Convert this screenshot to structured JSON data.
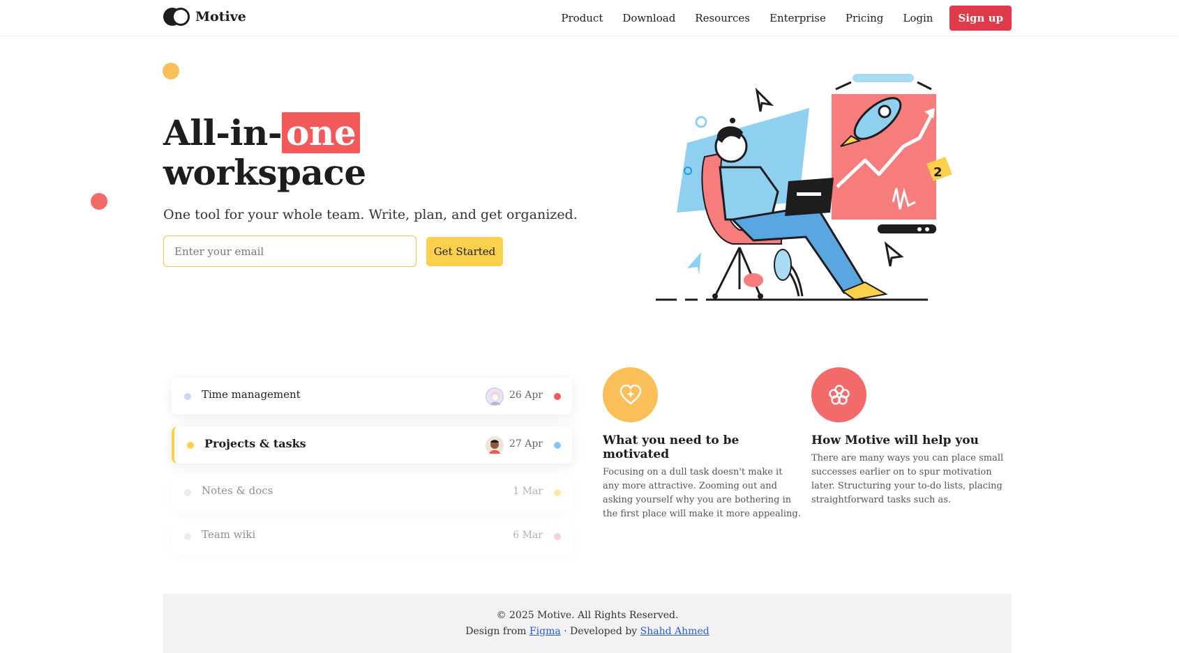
{
  "header": {
    "brand": "Motive",
    "nav": [
      "Product",
      "Download",
      "Resources",
      "Enterprise",
      "Pricing",
      "Login"
    ],
    "signup_label": "Sign up"
  },
  "hero": {
    "title_prefix": "All-in-",
    "title_highlight": "one",
    "title_line2": "workspace",
    "subtitle": "One tool for your whole team. Write, plan, and get organized.",
    "email_placeholder": "Enter your email",
    "cta_label": "Get Started"
  },
  "tasks": [
    {
      "name": "Time management",
      "date": "26 Apr",
      "bullet_color": "#c9d7f7",
      "status_color": "#f25a5a",
      "state": "normal"
    },
    {
      "name": "Projects & tasks",
      "date": "27 Apr",
      "bullet_color": "#fbd04c",
      "status_color": "#8ec5f0",
      "state": "active"
    },
    {
      "name": "Notes & docs",
      "date": "1 Mar",
      "bullet_color": "#d9d9d9",
      "status_color": "#fbd04c",
      "state": "faded"
    },
    {
      "name": "Team wiki",
      "date": "6 Mar",
      "bullet_color": "#d9d9d9",
      "status_color": "#f7a3a9",
      "state": "faded"
    }
  ],
  "features": [
    {
      "title": "What you need to be motivated",
      "text": "Focusing on a dull task doesn't make it any more attractive. Zooming out and asking yourself why you are bothering in the first place will make it more appealing.",
      "icon": "heart-sparkle-icon",
      "color": "#fbbf5a"
    },
    {
      "title": "How Motive will help you",
      "text": "There are many ways you can place small successes earlier on to spur motivation later. Structuring your to-do lists, placing straightforward tasks such as.",
      "icon": "flower-icon",
      "color": "#f26a6a"
    }
  ],
  "footer": {
    "copyright": "© 2025 Motive. All Rights Reserved.",
    "design_prefix": "Design from ",
    "design_link": "Figma",
    "separator": " · Developed by ",
    "dev_link": "Shahd Ahmed"
  },
  "colors": {
    "accent_red": "#e03a4a",
    "highlight_red": "#f25a5a",
    "accent_yellow": "#fbd04c",
    "accent_orange": "#fbbf5a"
  }
}
